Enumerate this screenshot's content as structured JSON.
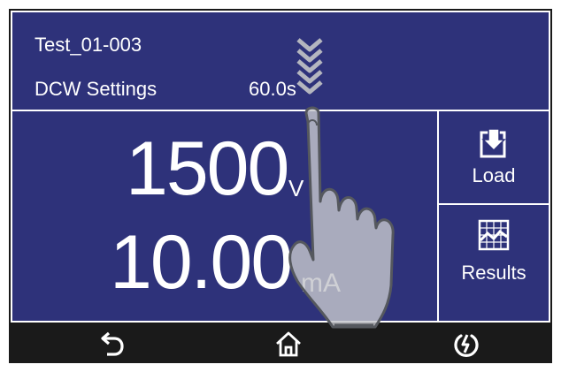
{
  "header": {
    "test_name": "Test_01-003",
    "settings_label": "DCW Settings",
    "settings_time": "60.0s"
  },
  "readout": {
    "voltage_value": "1500",
    "voltage_unit": "V",
    "current_value": "10.00",
    "current_unit": "mA"
  },
  "side_panel": {
    "load_label": "Load",
    "results_label": "Results"
  },
  "navbar": {
    "icons": [
      "back-arrow-icon",
      "home-icon",
      "power-icon"
    ]
  },
  "overlay": {
    "gesture": "swipe-down",
    "icons": [
      "chevron-down-icon",
      "hand-pointer-icon"
    ]
  },
  "colors": {
    "screen_bg": "#2e327a",
    "bezel": "#1a1a1a",
    "foreground": "#ffffff"
  }
}
